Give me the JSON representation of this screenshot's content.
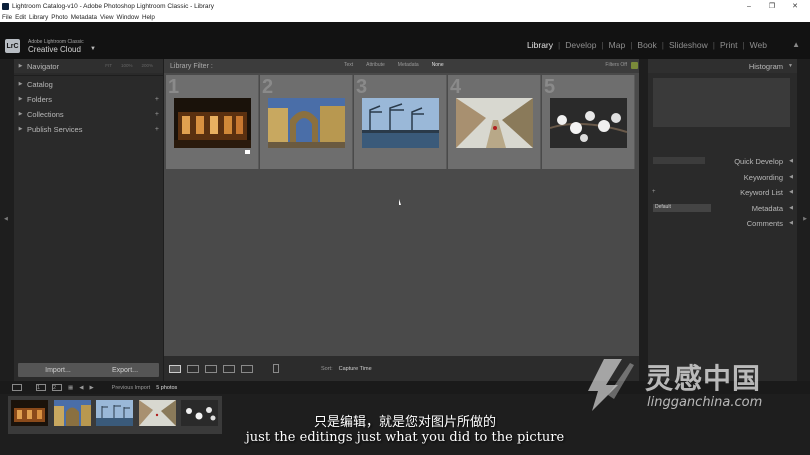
{
  "window": {
    "title": "Lightroom Catalog-v10 - Adobe Photoshop Lightroom Classic - Library",
    "controls": [
      "–",
      "❐",
      "✕"
    ]
  },
  "menu": [
    "File",
    "Edit",
    "Library",
    "Photo",
    "Metadata",
    "View",
    "Window",
    "Help"
  ],
  "identity": {
    "badge": "LrC",
    "brand_small": "Adobe Lightroom Classic",
    "brand_large": "Creative Cloud",
    "caret": "▼"
  },
  "modules": {
    "items": [
      "Library",
      "Develop",
      "Map",
      "Book",
      "Slideshow",
      "Print",
      "Web"
    ],
    "active": "Library"
  },
  "left_panel": {
    "navigator": {
      "label": "Navigator",
      "options": [
        "FIT",
        "100%",
        "200%"
      ]
    },
    "items": [
      {
        "label": "Catalog",
        "plus": ""
      },
      {
        "label": "Folders",
        "plus": "+"
      },
      {
        "label": "Collections",
        "plus": "+"
      },
      {
        "label": "Publish Services",
        "plus": "+"
      }
    ],
    "import_label": "Import...",
    "export_label": "Export..."
  },
  "library_filter": {
    "label": "Library Filter :",
    "options": [
      "Text",
      "Attribute",
      "Metadata",
      "None"
    ],
    "active": "None",
    "filters_off": "Filters Off"
  },
  "grid": {
    "cells": [
      {
        "number": "1",
        "subject": "night-building",
        "colors": [
          "#1a120a",
          "#8a4a1a",
          "#e0a050"
        ],
        "flagged": true
      },
      {
        "number": "2",
        "subject": "archway",
        "colors": [
          "#4a6ea8",
          "#c8a860",
          "#8a7040"
        ],
        "flagged": false
      },
      {
        "number": "3",
        "subject": "harbor-cranes",
        "colors": [
          "#9ab8d8",
          "#3a5a7a",
          "#2a3a4a"
        ],
        "flagged": false
      },
      {
        "number": "4",
        "subject": "garden-path",
        "colors": [
          "#d8d8d0",
          "#a89070",
          "#6a5a3a"
        ],
        "flagged": false
      },
      {
        "number": "5",
        "subject": "blossoms",
        "colors": [
          "#2a2a2a",
          "#f0f0f0",
          "#9a7a5a"
        ],
        "flagged": false
      }
    ]
  },
  "toolbar": {
    "sort_label": "Sort:",
    "sort_value": "Capture Time"
  },
  "right_panel": {
    "histogram": "Histogram",
    "items": [
      {
        "label": "Quick Develop"
      },
      {
        "label": "Keywording"
      },
      {
        "label": "Keyword List"
      },
      {
        "label": "Metadata"
      },
      {
        "label": "Comments"
      }
    ],
    "metadata_preset": "Default"
  },
  "filmstrip": {
    "page_one": "1",
    "page_two": "2",
    "source": "Previous Import",
    "count": "5 photos"
  },
  "subtitles": {
    "chinese": "只是编辑，就是您对图片所做的",
    "english": "just the editings just what you did to the picture"
  },
  "watermark": {
    "chinese": "灵感中国",
    "url": "lingganchina.com"
  }
}
